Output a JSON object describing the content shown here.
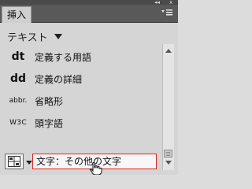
{
  "panel": {
    "tab_label": "挿入",
    "strip_left": "◂◂",
    "strip_right": "x"
  },
  "category": {
    "label": "テキスト"
  },
  "items": [
    {
      "icon_text": "dt",
      "label": "定義する用語"
    },
    {
      "icon_text": "dd",
      "label": "定義の詳細"
    },
    {
      "icon_text": "abbr.",
      "label": "省略形"
    },
    {
      "icon_text": "W3C",
      "label": "頭字語"
    }
  ],
  "selected": {
    "label": "文字：その他の文字"
  },
  "colors": {
    "selection_border": "#d8281f",
    "tab_bar": "#595959"
  },
  "icons": {
    "menu": "panel-menu-icon",
    "cursor": "hand-pointer-icon",
    "picker": "character-picker-icon"
  }
}
